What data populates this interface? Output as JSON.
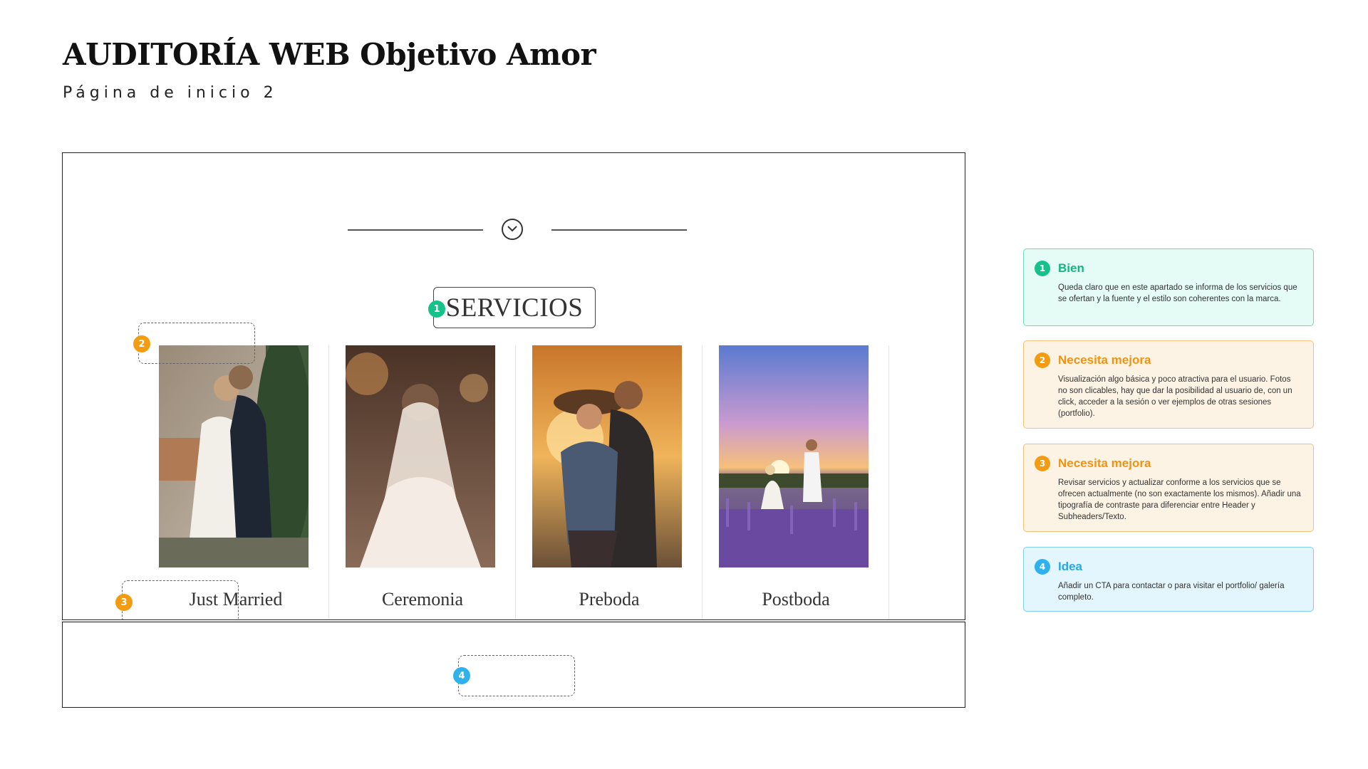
{
  "header": {
    "title": "AUDITORÍA WEB Objetivo Amor",
    "subtitle": "Página de inicio 2"
  },
  "mockup": {
    "section_title": "SERVICIOS",
    "services": [
      {
        "label": "Just Married",
        "image": "couple-kissing-photo"
      },
      {
        "label": "Ceremonia",
        "image": "bride-veil-photo"
      },
      {
        "label": "Preboda",
        "image": "couple-sunset-hug-photo"
      },
      {
        "label": "Postboda",
        "image": "couple-lavender-field-photo"
      }
    ],
    "markers": [
      "1",
      "2",
      "3",
      "4"
    ]
  },
  "notes": [
    {
      "num": "1",
      "status": "Bien",
      "color": "#14c28a",
      "text": "Queda claro que en este apartado se informa de los servicios que se ofertan y la fuente y el estilo son coherentes con la marca."
    },
    {
      "num": "2",
      "status": "Necesita mejora",
      "color": "#f39c12",
      "text": "Visualización algo básica y poco atractiva para el usuario. Fotos no son clicables, hay que dar la posibilidad al usuario de, con un click, acceder a la sesión o ver ejemplos de otras sesiones (portfolio)."
    },
    {
      "num": "3",
      "status": "Necesita mejora",
      "color": "#f39c12",
      "text": "Revisar servicios y actualizar conforme a los servicios que se ofrecen actualmente (no son exactamente los mismos). Añadir una tipografía de contraste para diferenciar entre Header y Subheaders/Texto."
    },
    {
      "num": "4",
      "status": "Idea",
      "color": "#2fb1ee",
      "text": "Añadir un CTA para contactar o para visitar el portfolio/ galería completo."
    }
  ]
}
